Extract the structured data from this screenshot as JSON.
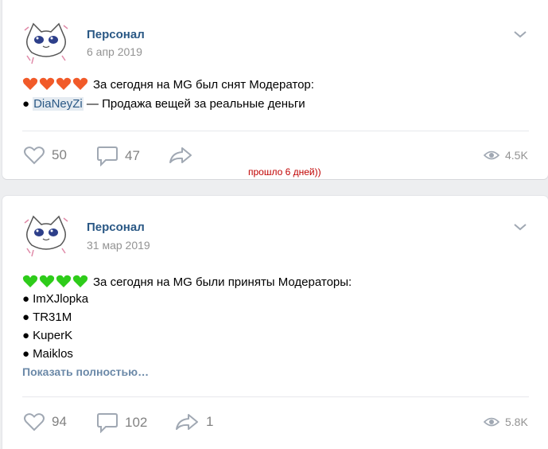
{
  "posts": [
    {
      "author": "Персонал",
      "date": "6 апр 2019",
      "text_line1": "За сегодня на MG был снят Модератор:",
      "line2_mention": "DiaNeyZi",
      "line2_rest": " — Продажа вещей за реальные деньги",
      "likes": "50",
      "comments": "47",
      "views": "4.5K",
      "heart_color": "#f15a29"
    },
    {
      "author": "Персонал",
      "date": "31 мар 2019",
      "text_line1": "За сегодня на MG были приняты Модераторы:",
      "list": [
        "ImXJlopka",
        "TR31M",
        "KuperK",
        "Maiklos"
      ],
      "show_more": "Показать полностью…",
      "likes": "94",
      "comments": "102",
      "shares": "1",
      "views": "5.8K",
      "heart_color": "#2ecc1a"
    }
  ],
  "annotation": "прошло 6 дней))",
  "bullet": "●",
  "icons": {
    "like": "heart-outline-icon",
    "comment": "speech-bubble-icon",
    "share": "share-arrow-icon",
    "views": "eye-icon",
    "menu": "chevron-down-icon"
  },
  "colors": {
    "link": "#2a5885",
    "muted": "#939393",
    "icon": "#a0a8b3",
    "annotation": "#c00000"
  }
}
